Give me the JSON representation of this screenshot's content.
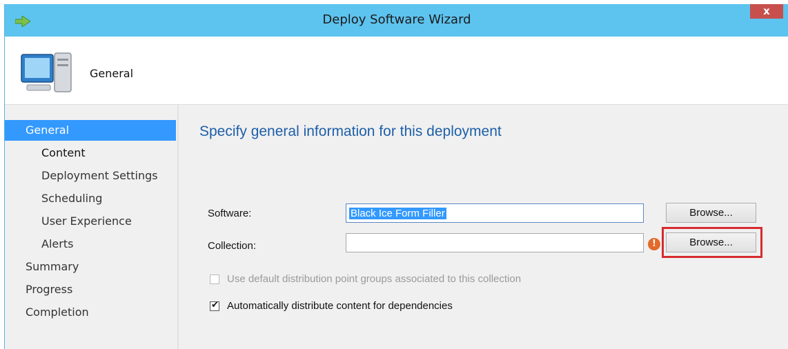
{
  "window": {
    "title": "Deploy Software Wizard",
    "close_label": "x",
    "app_icon": "green-arrow-icon"
  },
  "banner": {
    "title": "General",
    "icon": "computer-icon"
  },
  "nav": {
    "items": [
      {
        "label": "General",
        "selected": true,
        "level": 0
      },
      {
        "label": "Content",
        "selected": false,
        "level": 1
      },
      {
        "label": "Deployment Settings",
        "selected": false,
        "level": 1
      },
      {
        "label": "Scheduling",
        "selected": false,
        "level": 1
      },
      {
        "label": "User Experience",
        "selected": false,
        "level": 1
      },
      {
        "label": "Alerts",
        "selected": false,
        "level": 1
      },
      {
        "label": "Summary",
        "selected": false,
        "level": 0
      },
      {
        "label": "Progress",
        "selected": false,
        "level": 0
      },
      {
        "label": "Completion",
        "selected": false,
        "level": 0
      }
    ]
  },
  "content": {
    "heading": "Specify general information for this deployment",
    "software": {
      "label": "Software:",
      "value": "Black Ice Form Filler",
      "button": "Browse..."
    },
    "collection": {
      "label": "Collection:",
      "value": "",
      "button": "Browse...",
      "error_icon": "!"
    },
    "options": {
      "use_default_dp": {
        "label": "Use default distribution point groups associated to this collection",
        "checked": false,
        "enabled": false
      },
      "auto_distribute": {
        "label": "Automatically distribute content for dependencies",
        "checked": true,
        "enabled": true
      }
    }
  },
  "colors": {
    "titlebar": "#5dc3ef",
    "selected": "#3399ff",
    "heading": "#1e5fa8",
    "highlight": "#d72b2f"
  }
}
